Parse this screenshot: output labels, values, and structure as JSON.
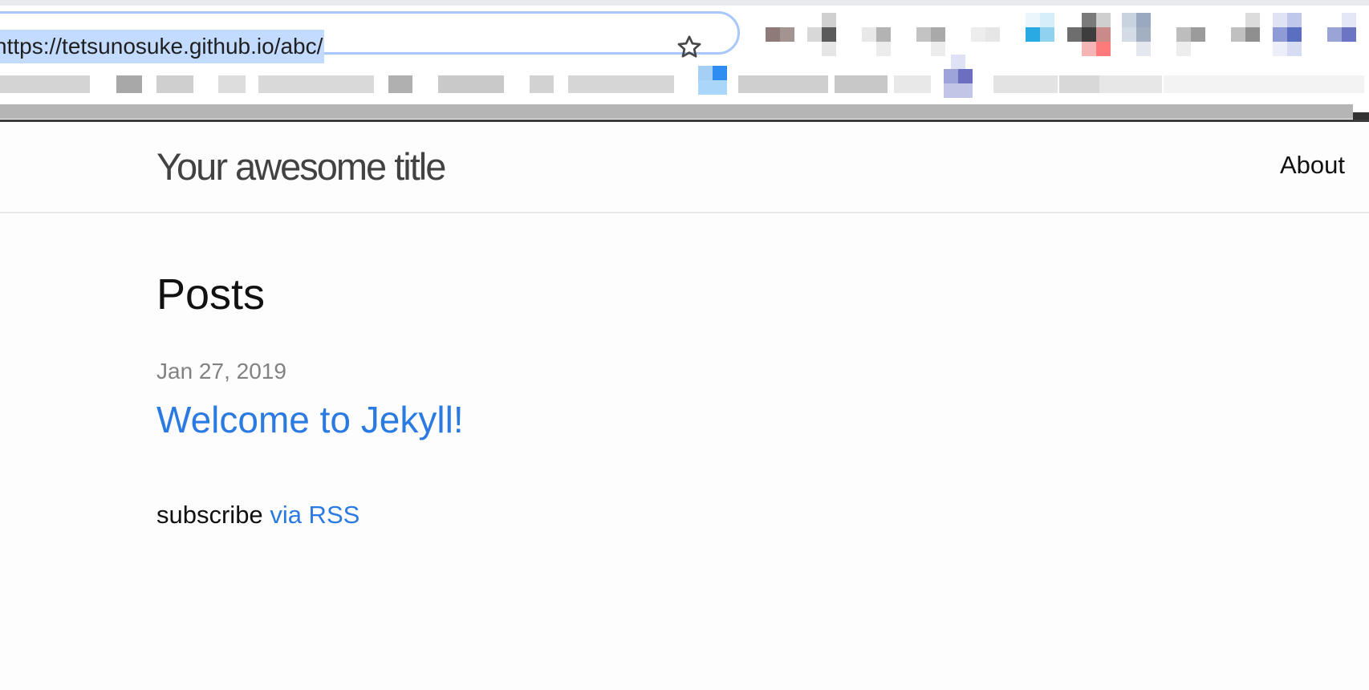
{
  "browser": {
    "url": "https://tetsunosuke.github.io/abc/",
    "bookmark_icon": "star-icon",
    "extension_colors": [
      "#8e7a78",
      "#5b5b5b",
      "#b3b3b3",
      "#a9a9a9",
      "#e6e6e6",
      "#29abe2",
      "#3d3d3d",
      "#ff7b7b",
      "#9aa9bd",
      "#9b9b9b",
      "#5a6fc0"
    ],
    "bookmark_colors": [
      "#a8a8a8",
      "#2f8cf0",
      "#6c6fbf"
    ]
  },
  "site": {
    "title": "Your awesome title",
    "nav": {
      "about": "About"
    }
  },
  "main": {
    "heading": "Posts",
    "posts": [
      {
        "date": "Jan 27, 2019",
        "title": "Welcome to Jekyll!"
      }
    ],
    "subscribe_prefix": "subscribe",
    "subscribe_link": "via RSS"
  },
  "colors": {
    "link": "#2a7ae2",
    "meta": "#828282",
    "title": "#424242",
    "url_selection": "#c2dbff"
  }
}
